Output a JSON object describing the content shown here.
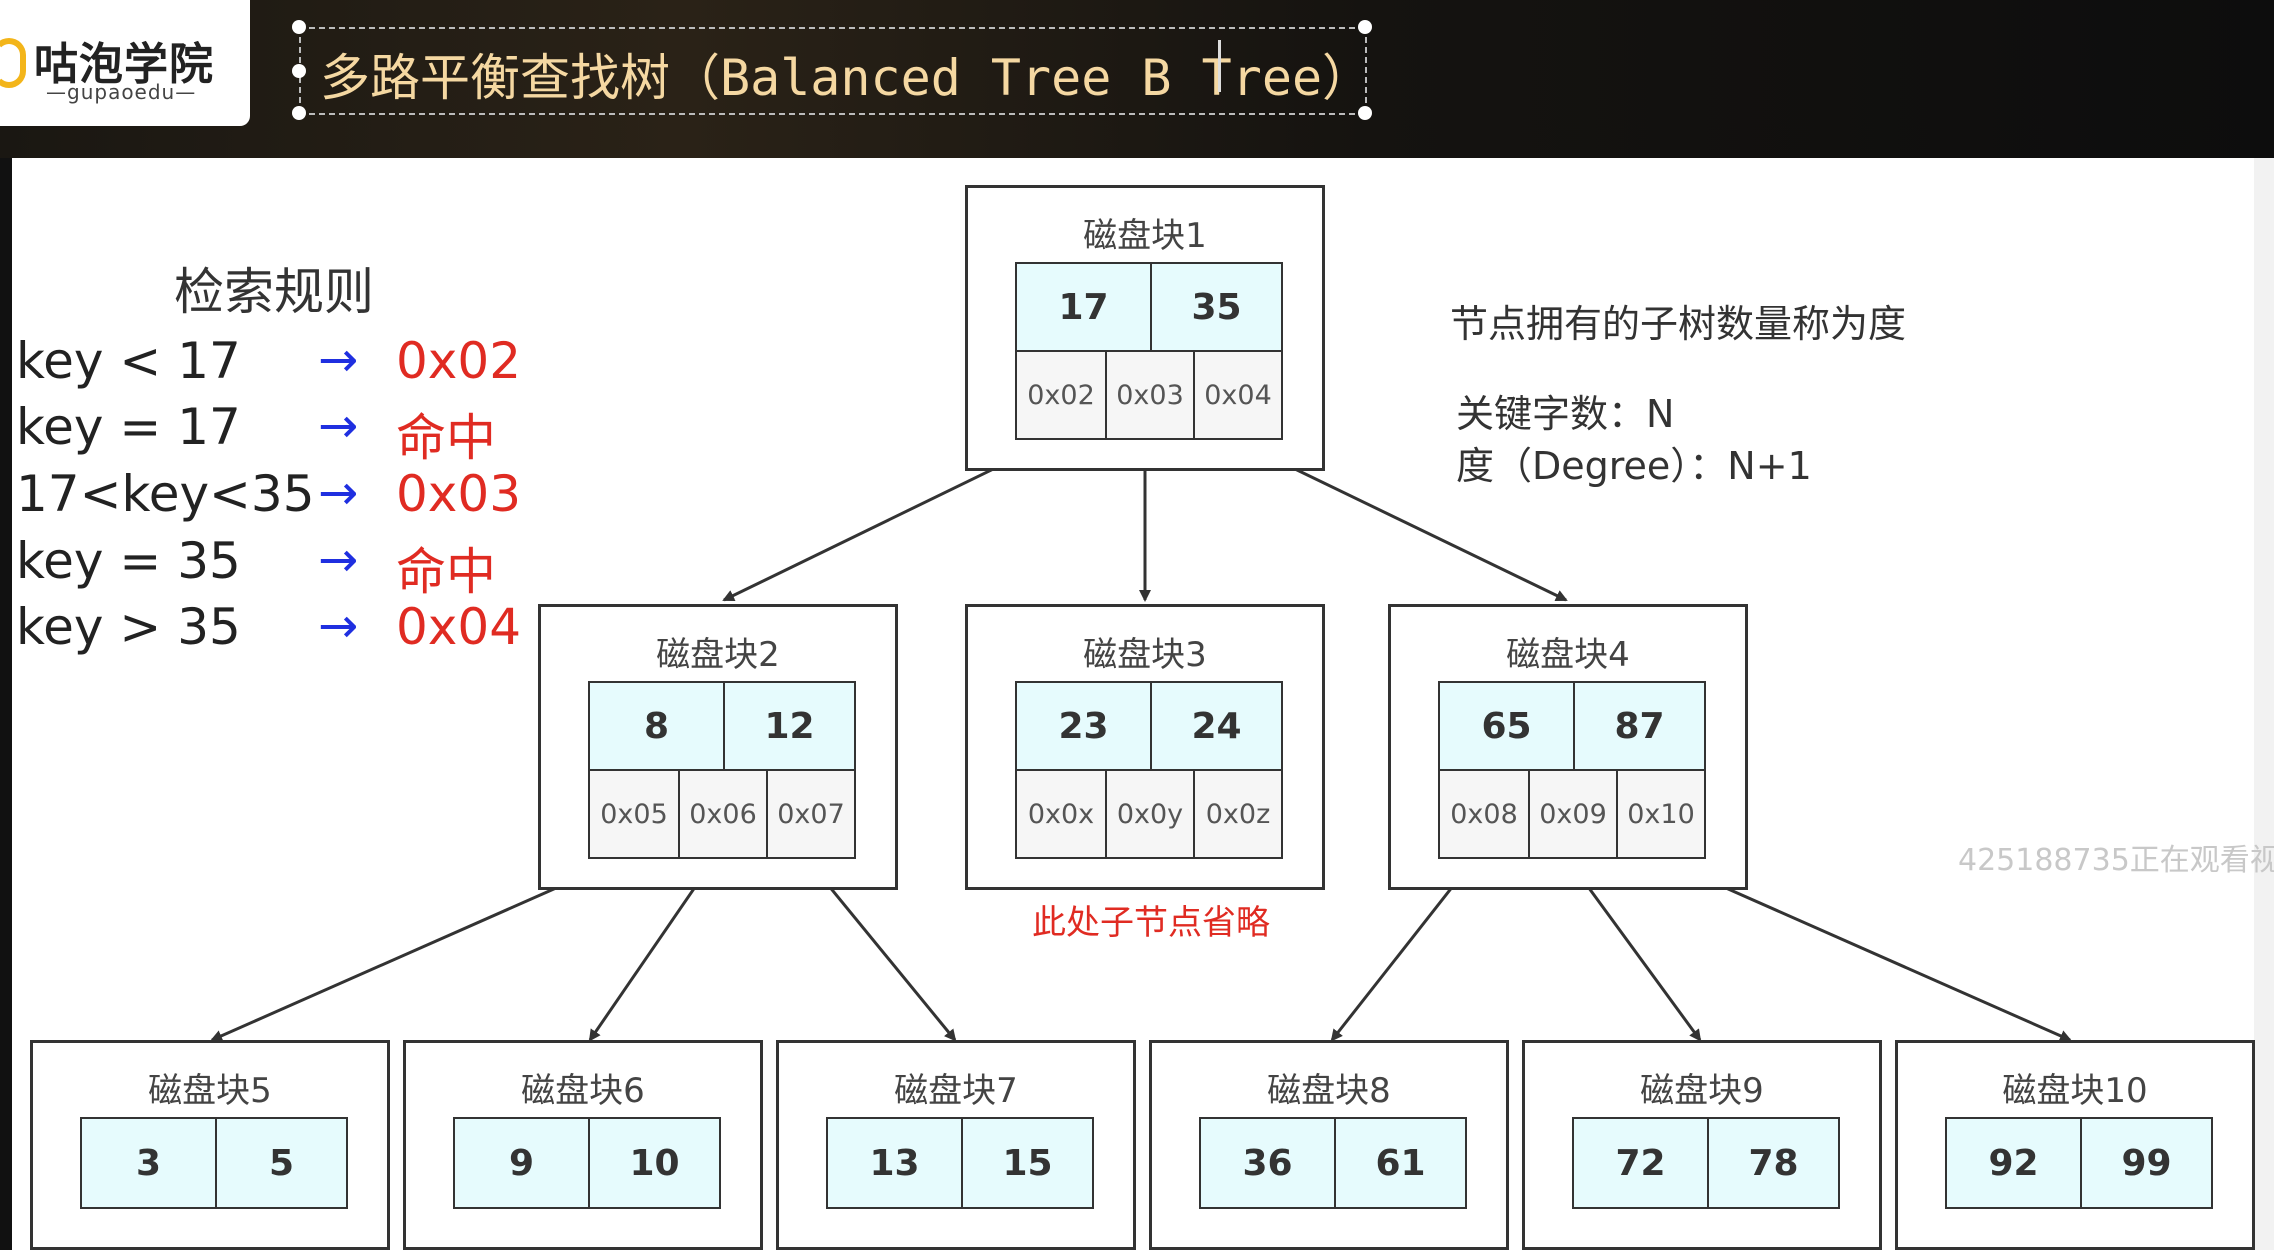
{
  "brand": {
    "name": "咕泡学院",
    "sub": "—gupaoedu—"
  },
  "slide_title": "多路平衡查找树（Balanced Tree  B Tree）",
  "rules": {
    "title": "检索规则",
    "items": [
      {
        "cond": "key < 17",
        "arrow": "→",
        "result": "0x02"
      },
      {
        "cond": "key = 17",
        "arrow": "→",
        "result": "命中"
      },
      {
        "cond": "17<key<35",
        "arrow": "→",
        "result": "0x03"
      },
      {
        "cond": "key = 35",
        "arrow": "→",
        "result": "命中"
      },
      {
        "cond": "key > 35",
        "arrow": "→",
        "result": "0x04"
      }
    ]
  },
  "notes": {
    "degree_def": "节点拥有的子树数量称为度",
    "keys": "关键字数：N",
    "degree": "度（Degree）：N+1"
  },
  "omitted_note": "此处子节点省略",
  "watermark": "425188735正在观看视",
  "colors": {
    "key_fill": "#e6fbfd",
    "pointer_fill": "#f6f6f6",
    "result_red": "#e02b22",
    "arrow_blue": "#1f2fe0"
  },
  "blocks": [
    {
      "title": "磁盘块1",
      "keys": [
        "17",
        "35"
      ],
      "pointers": [
        "0x02",
        "0x03",
        "0x04"
      ]
    },
    {
      "title": "磁盘块2",
      "keys": [
        "8",
        "12"
      ],
      "pointers": [
        "0x05",
        "0x06",
        "0x07"
      ]
    },
    {
      "title": "磁盘块3",
      "keys": [
        "23",
        "24"
      ],
      "pointers": [
        "0x0x",
        "0x0y",
        "0x0z"
      ]
    },
    {
      "title": "磁盘块4",
      "keys": [
        "65",
        "87"
      ],
      "pointers": [
        "0x08",
        "0x09",
        "0x10"
      ]
    },
    {
      "title": "磁盘块5",
      "keys": [
        "3",
        "5"
      ]
    },
    {
      "title": "磁盘块6",
      "keys": [
        "9",
        "10"
      ]
    },
    {
      "title": "磁盘块7",
      "keys": [
        "13",
        "15"
      ]
    },
    {
      "title": "磁盘块8",
      "keys": [
        "36",
        "61"
      ]
    },
    {
      "title": "磁盘块9",
      "keys": [
        "72",
        "78"
      ]
    },
    {
      "title": "磁盘块10",
      "keys": [
        "92",
        "99"
      ]
    }
  ]
}
